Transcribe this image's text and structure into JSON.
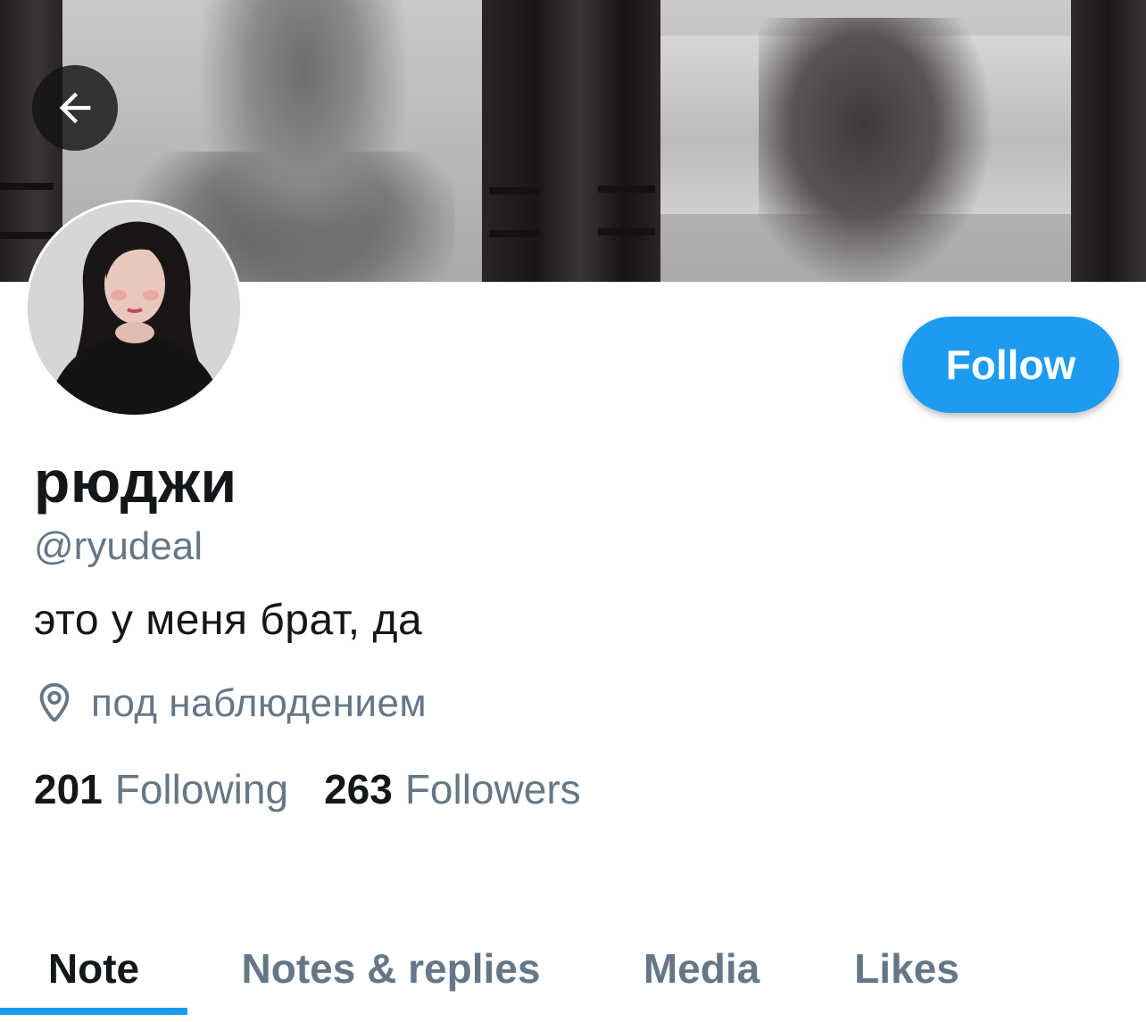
{
  "profile": {
    "display_name": "рюджи",
    "handle": "@ryudeal",
    "bio": "это у меня брат, да",
    "location": "под наблюдением"
  },
  "actions": {
    "follow_label": "Follow"
  },
  "stats": {
    "following_count": "201",
    "following_label": "Following",
    "followers_count": "263",
    "followers_label": "Followers"
  },
  "tabs": [
    {
      "label": "Note",
      "active": true
    },
    {
      "label": "Notes & replies",
      "active": false
    },
    {
      "label": "Media",
      "active": false
    },
    {
      "label": "Likes",
      "active": false
    }
  ],
  "colors": {
    "accent": "#1d9bf0",
    "text_primary": "#14171a",
    "text_secondary": "#657786"
  },
  "icons": {
    "back": "arrow-left-icon",
    "location": "location-pin-icon"
  }
}
